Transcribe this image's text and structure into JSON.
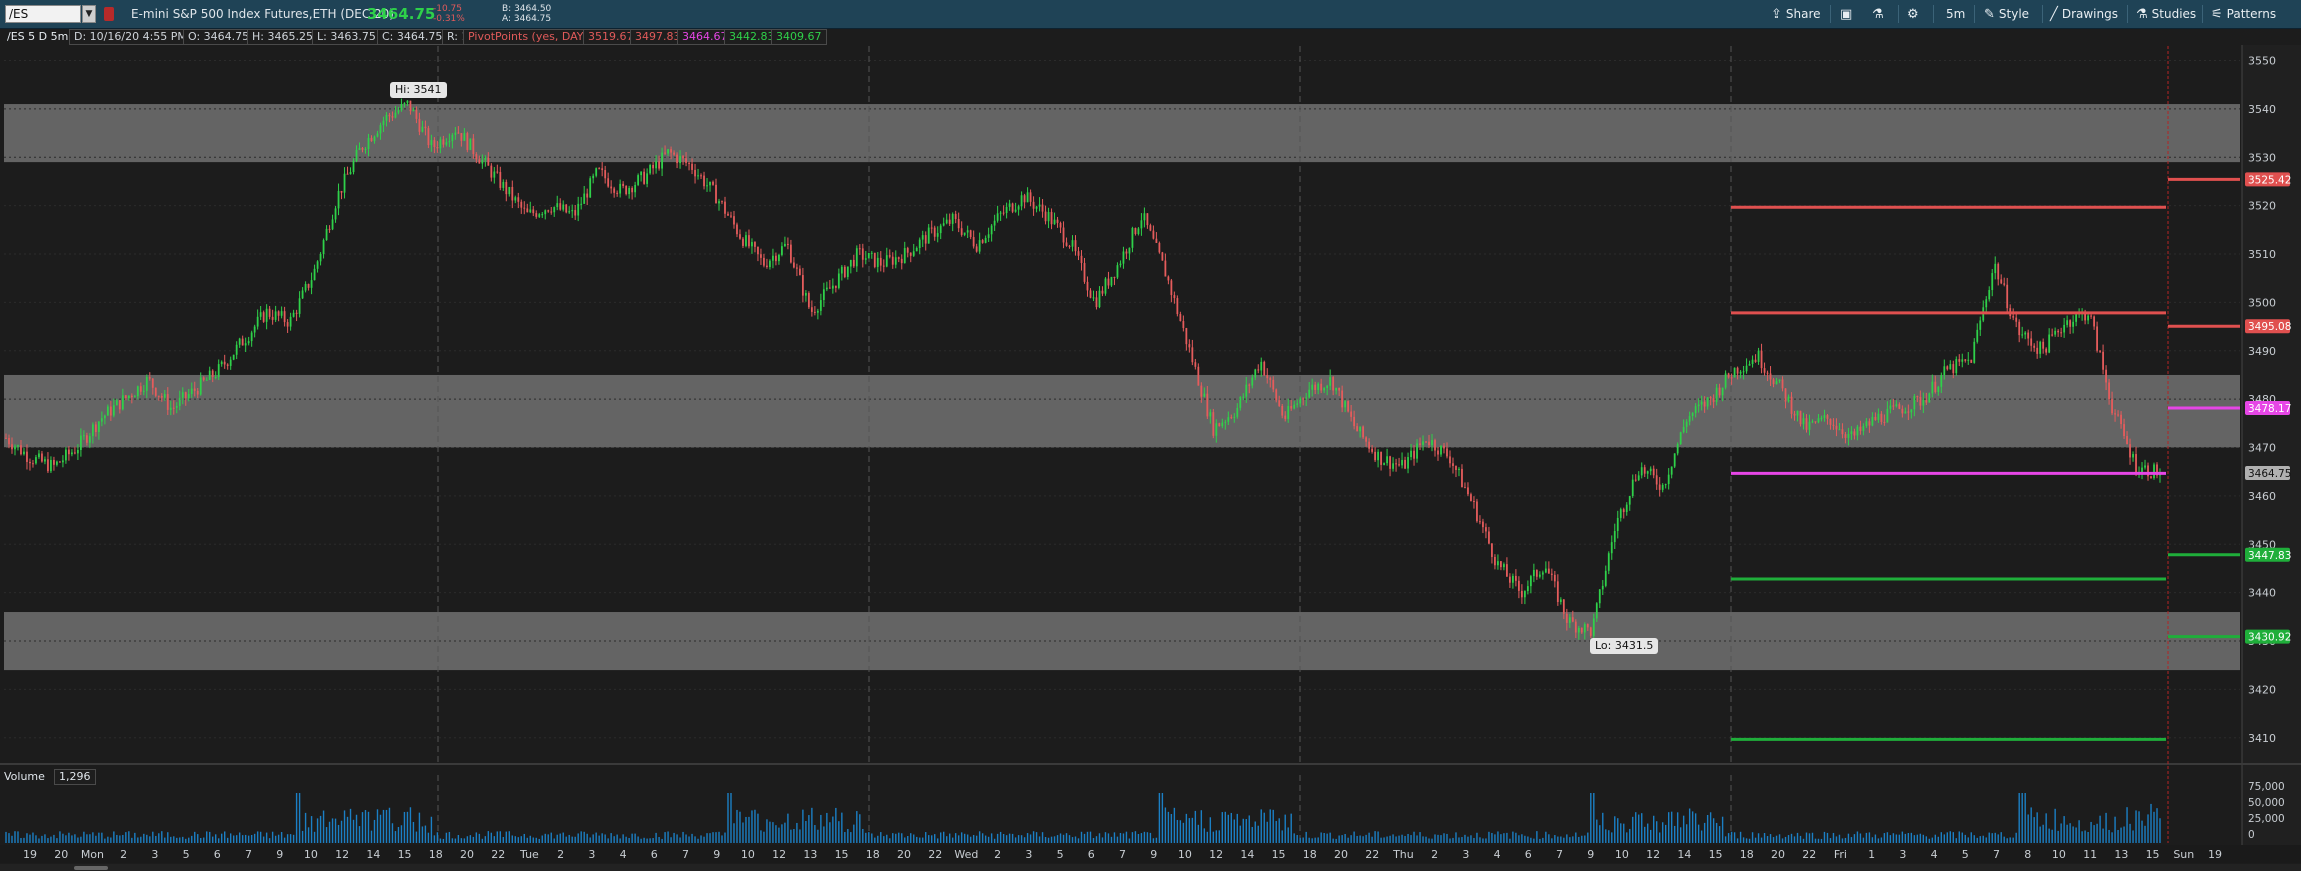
{
  "toolbar": {
    "symbol": "/ES",
    "instrument": "E-mini S&P 500 Index Futures,ETH (DEC 20)",
    "last_price": "3464.75",
    "change": "-10.75",
    "change_pct": "-0.31%",
    "bid": "B: 3464.50",
    "ask": "A: 3464.75",
    "share_label": "Share",
    "timeframe_label": "5m",
    "style_label": "Style",
    "drawings_label": "Drawings",
    "studies_label": "Studies",
    "patterns_label": "Patterns"
  },
  "infobar": {
    "chart_label": "/ES 5 D 5m",
    "date": "D: 10/16/20 4:55 PM",
    "open": "O: 3464.75",
    "high": "H: 3465.25",
    "low": "L: 3463.75",
    "close": "C: 3464.75",
    "range": "R: 1.5",
    "study_name": "PivotPoints (yes, DAY)",
    "pivot_values": [
      "3519.67",
      "3497.83",
      "3464.67",
      "3442.83",
      "3409.67"
    ]
  },
  "price_axis": {
    "ticks": [
      "3550",
      "3540",
      "3530",
      "3520",
      "3510",
      "3500",
      "3490",
      "3480",
      "3470",
      "3460",
      "3450",
      "3440",
      "3430",
      "3420",
      "3410"
    ],
    "markers": [
      {
        "label": "3525.42",
        "color": "#e0504f"
      },
      {
        "label": "3495.08",
        "color": "#e0504f"
      },
      {
        "label": "3478.17",
        "color": "#e646e6"
      },
      {
        "label": "3464.75",
        "color": "#b0b0b0"
      },
      {
        "label": "3447.83",
        "color": "#1fae3a"
      },
      {
        "label": "3430.92",
        "color": "#1fae3a"
      }
    ]
  },
  "callouts": {
    "high": "Hi: 3541",
    "low": "Lo: 3431.5"
  },
  "volume": {
    "label": "Volume",
    "value": "1,296",
    "ticks": [
      "75,000",
      "50,000",
      "25,000",
      "0"
    ]
  },
  "time_axis": {
    "labels": [
      "19",
      "20",
      "Mon",
      "2",
      "3",
      "5",
      "6",
      "7",
      "9",
      "10",
      "12",
      "14",
      "15",
      "18",
      "20",
      "22",
      "Tue",
      "2",
      "3",
      "4",
      "6",
      "7",
      "9",
      "10",
      "12",
      "13",
      "15",
      "18",
      "20",
      "22",
      "Wed",
      "2",
      "3",
      "5",
      "6",
      "7",
      "9",
      "10",
      "12",
      "14",
      "15",
      "18",
      "20",
      "22",
      "Thu",
      "2",
      "3",
      "4",
      "6",
      "7",
      "9",
      "10",
      "12",
      "14",
      "15",
      "18",
      "20",
      "22",
      "Fri",
      "1",
      "3",
      "4",
      "5",
      "7",
      "8",
      "10",
      "11",
      "13",
      "15",
      "Sun",
      "19"
    ]
  },
  "chart_data": {
    "type": "candlestick",
    "symbol": "/ES",
    "timeframe": "5m",
    "ylim": [
      3405,
      3553
    ],
    "high": 3541,
    "low": 3431.5,
    "last": 3464.75,
    "gray_zones": [
      [
        3529,
        3541
      ],
      [
        3470,
        3485
      ],
      [
        3424,
        3436
      ]
    ],
    "pivot_levels": [
      {
        "value": 3519.67,
        "color": "#e0504f"
      },
      {
        "value": 3497.83,
        "color": "#e0504f"
      },
      {
        "value": 3464.67,
        "color": "#e646e6"
      },
      {
        "value": 3442.83,
        "color": "#1fae3a"
      },
      {
        "value": 3409.67,
        "color": "#1fae3a"
      }
    ],
    "next_levels": [
      {
        "value": 3525.42,
        "color": "#e0504f"
      },
      {
        "value": 3495.08,
        "color": "#e0504f"
      },
      {
        "value": 3478.17,
        "color": "#e646e6"
      },
      {
        "value": 3447.83,
        "color": "#1fae3a"
      },
      {
        "value": 3430.92,
        "color": "#1fae3a"
      }
    ],
    "price_path": [
      3472,
      3468,
      3466,
      3470,
      3476,
      3480,
      3484,
      3478,
      3482,
      3486,
      3492,
      3498,
      3496,
      3506,
      3522,
      3532,
      3538,
      3541,
      3532,
      3536,
      3530,
      3524,
      3518,
      3520,
      3518,
      3527,
      3523,
      3526,
      3531,
      3528,
      3522,
      3514,
      3508,
      3512,
      3498,
      3504,
      3510,
      3508,
      3510,
      3514,
      3517,
      3512,
      3518,
      3522,
      3518,
      3512,
      3500,
      3508,
      3518,
      3506,
      3490,
      3474,
      3478,
      3488,
      3476,
      3482,
      3484,
      3474,
      3468,
      3466,
      3472,
      3468,
      3458,
      3446,
      3440,
      3446,
      3434,
      3432,
      3454,
      3466,
      3462,
      3476,
      3480,
      3486,
      3489,
      3482,
      3474,
      3476,
      3472,
      3476,
      3478,
      3480,
      3486,
      3488,
      3508,
      3494,
      3490,
      3496,
      3498,
      3478,
      3466,
      3464.75
    ]
  },
  "colors": {
    "up": "#2fd14a",
    "down": "#e55c5c",
    "zone": "#6a6a6a",
    "toolbar": "#1f4356",
    "volume": "#1b7fc4"
  }
}
